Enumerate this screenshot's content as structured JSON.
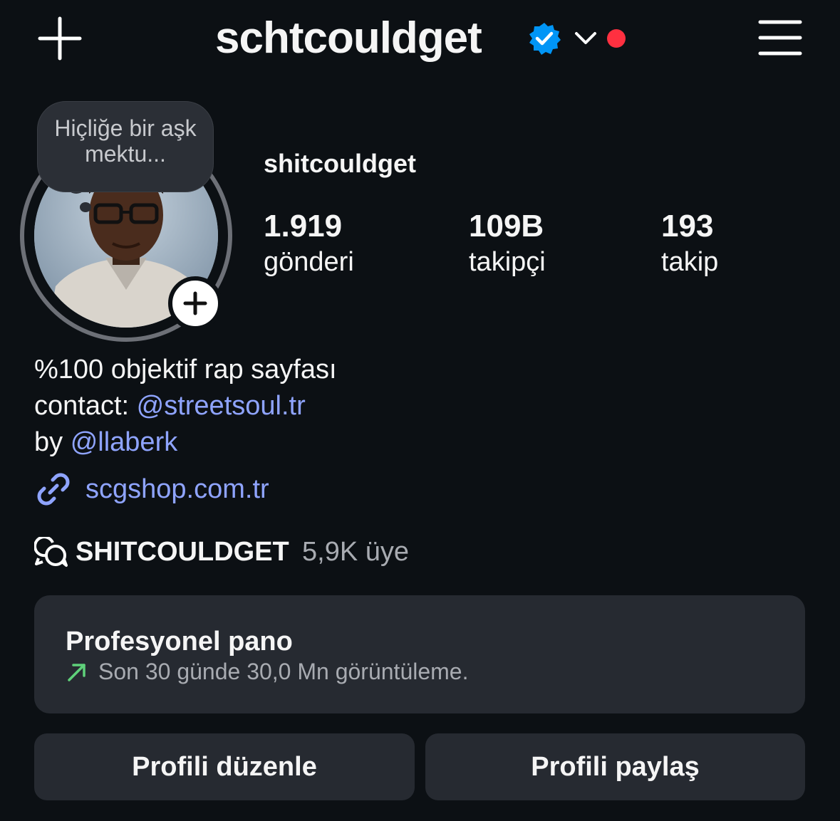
{
  "header": {
    "title": "schtcouldget",
    "verified": true,
    "has_notification_dot": true,
    "icons": [
      "plus-icon",
      "verified-badge-icon",
      "chevron-down-icon",
      "menu-icon"
    ]
  },
  "profile": {
    "note": "Hiçliğe bir aşk mektu...",
    "username": "shitcouldget",
    "stats": [
      {
        "value": "1.919",
        "label": "gönderi"
      },
      {
        "value": "109B",
        "label": "takipçi"
      },
      {
        "value": "193",
        "label": "takip"
      }
    ]
  },
  "bio": {
    "line1": "%100 objektif rap sayfası",
    "line2_prefix": "contact: ",
    "line2_mention": "@streetsoul.tr",
    "line3_prefix": "by ",
    "line3_mention": "@llaberk",
    "website": "scgshop.com.tr",
    "channel_name": "SHITCOULDGET",
    "channel_members": "5,9K üye"
  },
  "dashboard": {
    "title": "Profesyonel pano",
    "subtitle": "Son 30 günde 30,0 Mn görüntüleme."
  },
  "buttons": {
    "edit": "Profili düzenle",
    "share": "Profili paylaş"
  },
  "colors": {
    "background": "#0c1014",
    "card": "#262a31",
    "link": "#8fa4ff",
    "verified": "#0095f6",
    "notification": "#ff3040",
    "trend_up": "#5fd17a"
  }
}
